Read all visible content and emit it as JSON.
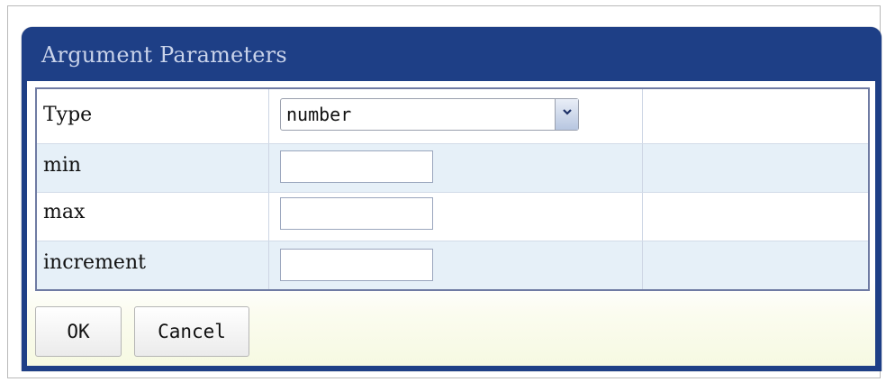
{
  "dialog": {
    "title": "Argument Parameters"
  },
  "params": {
    "type": {
      "label": "Type",
      "selected": "number"
    },
    "min": {
      "label": "min",
      "value": ""
    },
    "max": {
      "label": "max",
      "value": ""
    },
    "increment": {
      "label": "increment",
      "value": ""
    }
  },
  "buttons": {
    "ok": "OK",
    "cancel": "Cancel"
  },
  "icons": {
    "dropdown": "chevron-down-icon"
  },
  "colors": {
    "title_bar": "#1e3f86",
    "title_text": "#c9d3ea",
    "alt_row": "#e6f0f8"
  }
}
